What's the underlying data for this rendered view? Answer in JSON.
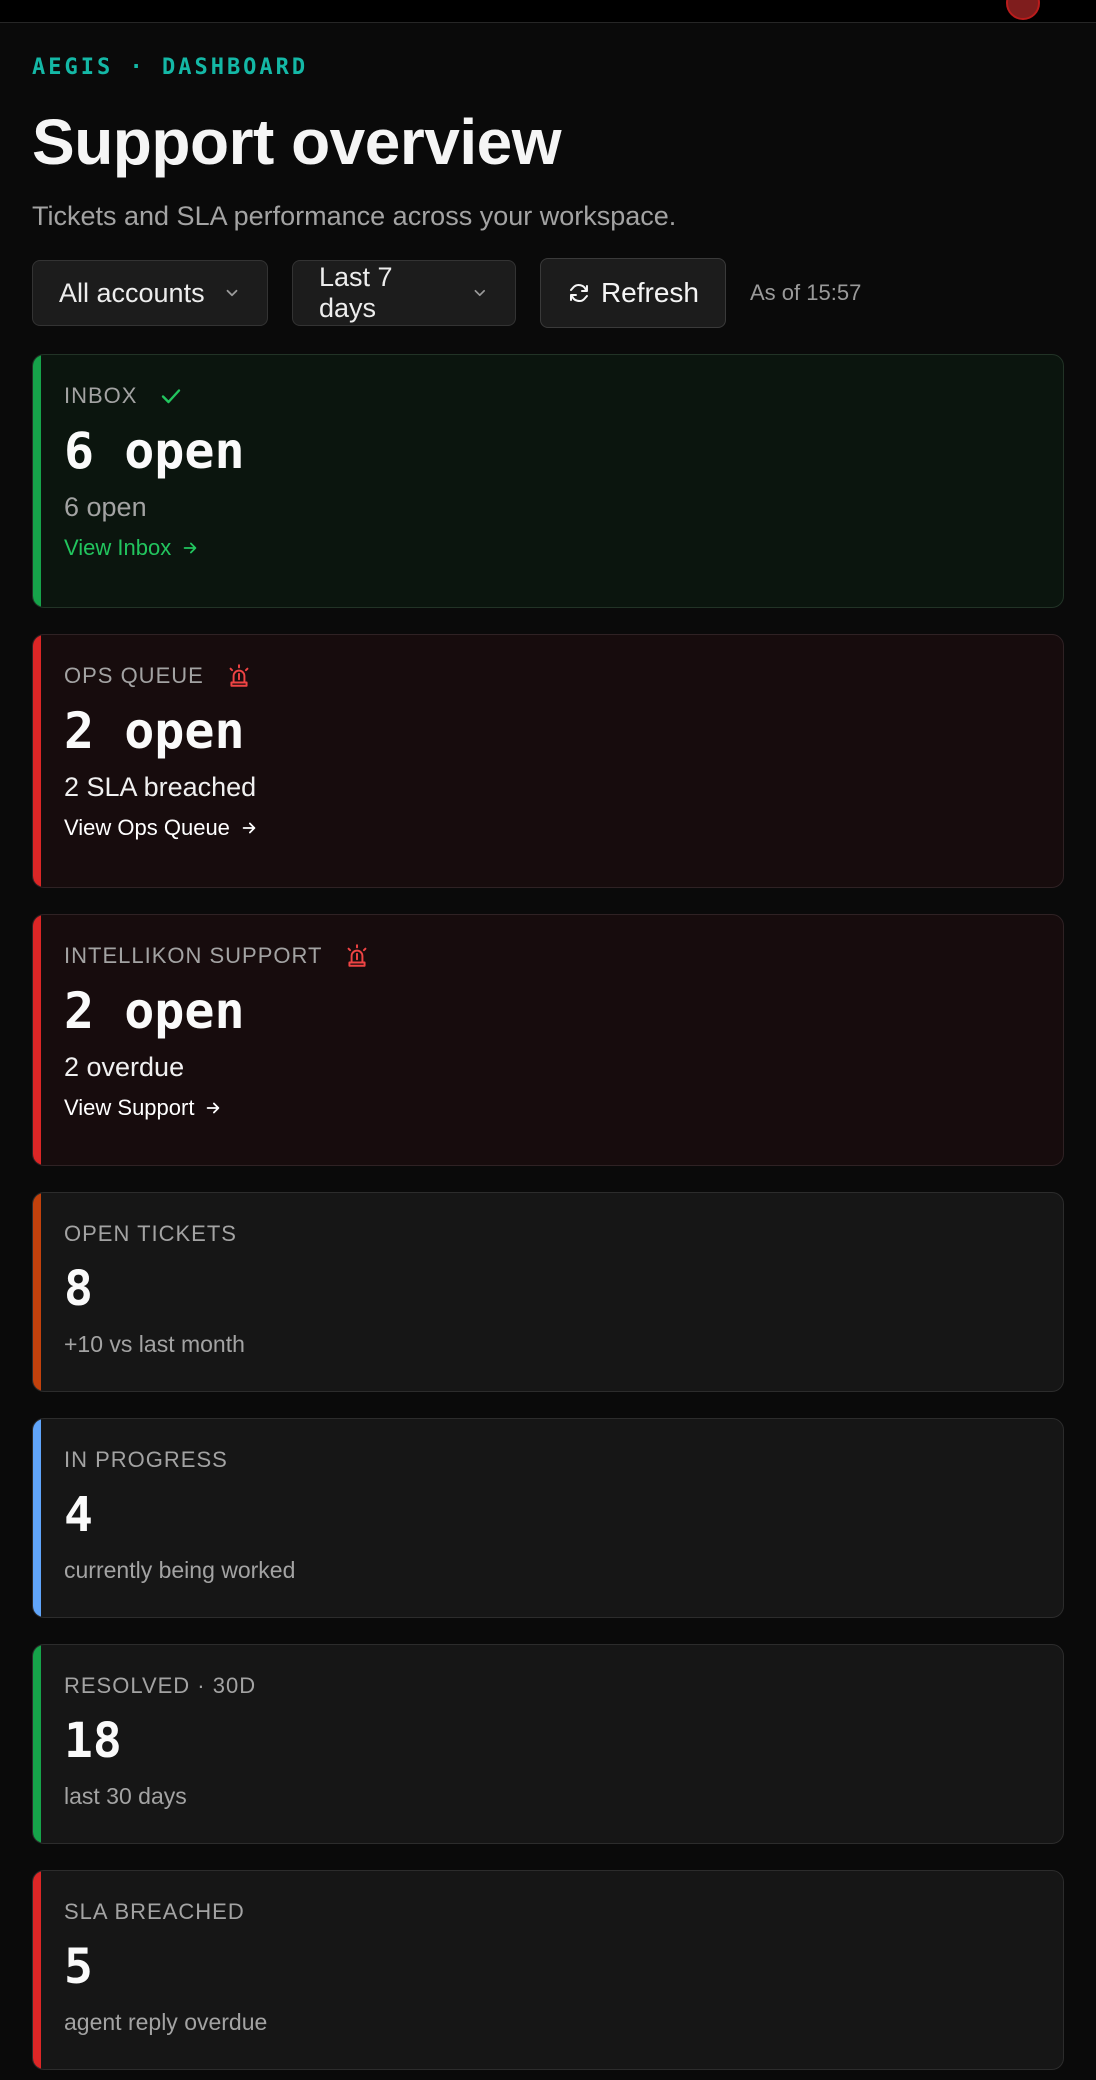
{
  "header": {
    "eyebrow": "AEGIS · DASHBOARD",
    "title": "Support overview",
    "subtitle": "Tickets and SLA performance across your workspace."
  },
  "toolbar": {
    "account_select": "All accounts",
    "range_select": "Last 7 days",
    "refresh_label": "Refresh",
    "as_of": "As of 15:57"
  },
  "queues": [
    {
      "label": "INBOX",
      "value": "6 open",
      "sub": "6 open",
      "link": "View Inbox",
      "status_icon": "check-icon",
      "accent": "#16a34a",
      "link_color": "#22c55e"
    },
    {
      "label": "OPS QUEUE",
      "value": "2 open",
      "sub": "2 SLA breached",
      "link": "View Ops Queue",
      "status_icon": "siren-icon",
      "accent": "#dc2626",
      "link_color": "#ffffff"
    },
    {
      "label": "INTELLIKON SUPPORT",
      "value": "2 open",
      "sub": "2 overdue",
      "link": "View Support",
      "status_icon": "siren-icon",
      "accent": "#dc2626",
      "link_color": "#ffffff"
    }
  ],
  "stats": [
    {
      "label": "OPEN TICKETS",
      "value": "8",
      "sub": "+10 vs last month",
      "accent": "#c2410c"
    },
    {
      "label": "IN PROGRESS",
      "value": "4",
      "sub": "currently being worked",
      "accent": "#60a5fa"
    },
    {
      "label": "RESOLVED · 30D",
      "value": "18",
      "sub": "last 30 days",
      "accent": "#16a34a"
    },
    {
      "label": "SLA BREACHED",
      "value": "5",
      "sub": "agent reply overdue",
      "accent": "#dc2626"
    }
  ]
}
